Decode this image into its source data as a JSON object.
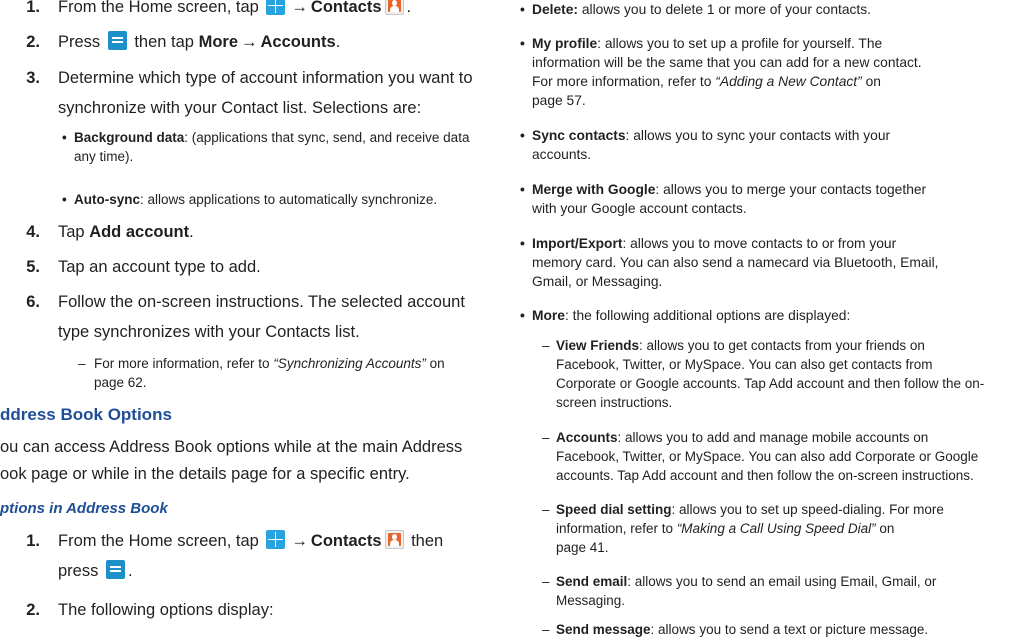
{
  "left": {
    "steps_top": [
      {
        "num": "1.",
        "parts": [
          {
            "t": "From the Home screen, tap "
          },
          {
            "icon": "home-grid-icon"
          },
          {
            "t": "→",
            "cls": "arrow"
          },
          {
            "t": "Contacts",
            "cls": "b"
          },
          {
            "icon": "contacts-icon"
          },
          {
            "t": "."
          }
        ]
      },
      {
        "num": "2.",
        "parts": [
          {
            "t": "Press "
          },
          {
            "icon": "menu-key-icon"
          },
          {
            "t": " then tap "
          },
          {
            "t": "More",
            "cls": "b"
          },
          {
            "t": "→",
            "cls": "arrow"
          },
          {
            "t": "Accounts",
            "cls": "b"
          },
          {
            "t": "."
          }
        ]
      },
      {
        "num": "3.",
        "lines": [
          "Determine which type of account information you want to",
          "synchronize with your Contact list. Selections are:"
        ]
      }
    ],
    "bullets": [
      {
        "lines": [
          [
            {
              "t": "Background data",
              "cls": "b"
            },
            {
              "t": ": (applications that sync, send, and receive data"
            }
          ],
          [
            {
              "t": "any time)."
            }
          ]
        ]
      },
      {
        "lines": [
          [
            {
              "t": "Auto-sync",
              "cls": "b"
            },
            {
              "t": ": allows applications to automatically synchronize."
            }
          ]
        ]
      }
    ],
    "steps_mid": [
      {
        "num": "4.",
        "parts": [
          {
            "t": "Tap "
          },
          {
            "t": "Add account",
            "cls": "b"
          },
          {
            "t": "."
          }
        ]
      },
      {
        "num": "5.",
        "parts": [
          {
            "t": "Tap an account type to add."
          }
        ]
      },
      {
        "num": "6.",
        "lines": [
          "Follow the on-screen instructions. The selected account",
          "type synchronizes with your Contacts list."
        ]
      }
    ],
    "dash_note": {
      "lines": [
        [
          {
            "t": "For more information, refer to "
          },
          {
            "t": "“Synchronizing Accounts”",
            "cls": "it"
          },
          {
            "t": " on"
          }
        ],
        [
          {
            "t": "page 62."
          }
        ]
      ]
    },
    "section_heading": "ddress Book Options",
    "section_para": [
      "ou can access Address Book options while at the main Address",
      "ook page or while in the details page for a specific entry."
    ],
    "sub_heading": "ptions in Address Book",
    "steps_bottom": [
      {
        "num": "1.",
        "lines_parts": [
          [
            {
              "t": "From the Home screen, tap "
            },
            {
              "icon": "home-grid-icon"
            },
            {
              "t": "→",
              "cls": "arrow"
            },
            {
              "t": "Contacts",
              "cls": "b"
            },
            {
              "icon": "contacts-icon"
            },
            {
              "t": " then"
            }
          ],
          [
            {
              "t": "press "
            },
            {
              "icon": "menu-key-icon"
            },
            {
              "t": "."
            }
          ]
        ]
      },
      {
        "num": "2.",
        "lines_parts": [
          [
            {
              "t": "The following options display:"
            }
          ]
        ]
      }
    ]
  },
  "right": {
    "bullets": [
      {
        "lines": [
          [
            {
              "t": "Delete:",
              "cls": "b"
            },
            {
              "t": " allows you to delete 1 or more of your contacts."
            }
          ]
        ]
      },
      {
        "lines": [
          [
            {
              "t": "My profile",
              "cls": "b"
            },
            {
              "t": ": allows you to set up a profile for yourself. The"
            }
          ],
          [
            {
              "t": "information will be the same that you can add for a new contact."
            }
          ],
          [
            {
              "t": "For more information, refer to "
            },
            {
              "t": "“Adding a New Contact”",
              "cls": "it"
            },
            {
              "t": " on"
            }
          ],
          [
            {
              "t": "page 57."
            }
          ]
        ]
      },
      {
        "lines": [
          [
            {
              "t": "Sync contacts",
              "cls": "b"
            },
            {
              "t": ": allows you to sync your contacts with your"
            }
          ],
          [
            {
              "t": "accounts."
            }
          ]
        ]
      },
      {
        "lines": [
          [
            {
              "t": "Merge with Google",
              "cls": "b"
            },
            {
              "t": ": allows you to merge your contacts together"
            }
          ],
          [
            {
              "t": "with your Google account contacts."
            }
          ]
        ]
      },
      {
        "lines": [
          [
            {
              "t": "Import/Export",
              "cls": "b"
            },
            {
              "t": ": allows you to move contacts to or from your"
            }
          ],
          [
            {
              "t": "memory card. You can also send a namecard via Bluetooth, Email,"
            }
          ],
          [
            {
              "t": "Gmail, or Messaging."
            }
          ]
        ]
      },
      {
        "lines": [
          [
            {
              "t": "More",
              "cls": "b"
            },
            {
              "t": ": the following additional options are displayed:"
            }
          ]
        ]
      }
    ],
    "dashes": [
      {
        "lines": [
          [
            {
              "t": "View Friends",
              "cls": "b"
            },
            {
              "t": ": allows you to get contacts from your friends on"
            }
          ],
          [
            {
              "t": "Facebook, Twitter, or MySpace. You can also get contacts from"
            }
          ],
          [
            {
              "t": "Corporate or Google accounts. Tap Add account and then follow the on-"
            }
          ],
          [
            {
              "t": "screen instructions."
            }
          ]
        ]
      },
      {
        "lines": [
          [
            {
              "t": "Accounts",
              "cls": "b"
            },
            {
              "t": ": allows you to add and manage mobile accounts on"
            }
          ],
          [
            {
              "t": "Facebook, Twitter, or MySpace. You can also add Corporate or Google"
            }
          ],
          [
            {
              "t": "accounts. Tap Add account and then follow the on-screen instructions."
            }
          ]
        ]
      },
      {
        "lines": [
          [
            {
              "t": "Speed dial setting",
              "cls": "b"
            },
            {
              "t": ": allows you to set up speed-dialing. For more"
            }
          ],
          [
            {
              "t": "information, refer to "
            },
            {
              "t": "“Making a Call Using Speed Dial”",
              "cls": "it"
            },
            {
              "t": " on"
            }
          ],
          [
            {
              "t": "page 41."
            }
          ]
        ]
      },
      {
        "lines": [
          [
            {
              "t": "Send email",
              "cls": "b"
            },
            {
              "t": ": allows you to send an email using Email, Gmail, or"
            }
          ],
          [
            {
              "t": "Messaging."
            }
          ]
        ]
      },
      {
        "lines": [
          [
            {
              "t": "Send message",
              "cls": "b"
            },
            {
              "t": ": allows you to send a text or picture message."
            }
          ]
        ]
      }
    ]
  }
}
